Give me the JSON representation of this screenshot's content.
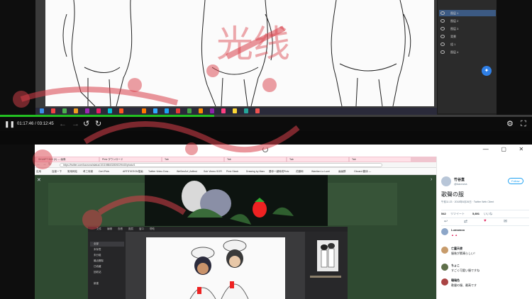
{
  "player": {
    "current_time": "01:17:46",
    "duration": "03:12:45",
    "time_separator": " / ",
    "progress_fraction": 0.403,
    "progress_color": "#23c021",
    "icons": [
      "pause-icon",
      "prev-icon",
      "next-icon",
      "rewind-10-icon",
      "forward-10-icon",
      "settings-icon",
      "fullscreen-icon"
    ]
  },
  "top_screen": {
    "layers": [
      "图层 1",
      "图层 2",
      "图层 3",
      "背景",
      "组 1",
      "图层 4",
      "图层 5"
    ],
    "messenger_icon": "messenger-icon"
  },
  "bottom_screen": {
    "browser_tabs": [
      "SKU6PT B00 (0) — 画像",
      "Pixiv ダウンロード",
      "Tab",
      "Tab",
      "Tab",
      "Tab"
    ],
    "url": "https://twitter.com/kaoruna/status/1011988432839229440/photo/1",
    "bookmarks": [
      "应用",
      "百度一下",
      "常用网站",
      "考三传媒",
      "Cerf-Pixiv",
      "ARTSTATION插画",
      "Twitter Video Dow...",
      "WeSeeArt | Artfest",
      "Sub Vimeo SOFI",
      "Pixiv Stack",
      "Drawing by Marc",
      "要你一键转成Pixiv",
      "花瓣网",
      "Wanlian Lo Lumi",
      "画画群",
      "Gboard 翻译 —",
      ""
    ],
    "editor_menu": [
      "文件",
      "编辑",
      "查看",
      "图层",
      "窗口",
      "帮助"
    ],
    "editor_items": [
      "全部",
      "未标签",
      "未分组",
      "最近删除",
      "已收藏",
      "回收站",
      "新建",
      "新建文件夹"
    ],
    "twitter": {
      "display_name": "竹谷直",
      "handle": "@kaoruna",
      "follow_label": "Follow",
      "tweet_text": "歌聲の服",
      "meta": "午前11:23 · 2018年6月26日 · Twitter Web Client",
      "retweets": "542",
      "likes": "5,891",
      "retweets_label": "リツイート",
      "likes_label": "いいね",
      "replies": [
        {
          "name": "Lumamoo",
          "text": "▲ ▲"
        },
        {
          "name": "亡霊天使",
          "text": "服装が素晴らしい！"
        },
        {
          "name": "ちょこ",
          "text": "すごく可愛い服ですね"
        },
        {
          "name": "瑠璃色",
          "text": "歌聲の服、最高です"
        }
      ]
    }
  },
  "watermark": {
    "text": "光线",
    "color": "#d9404a"
  },
  "window_controls": {
    "minimize": "—",
    "maximize": "▢",
    "close": "✕"
  }
}
